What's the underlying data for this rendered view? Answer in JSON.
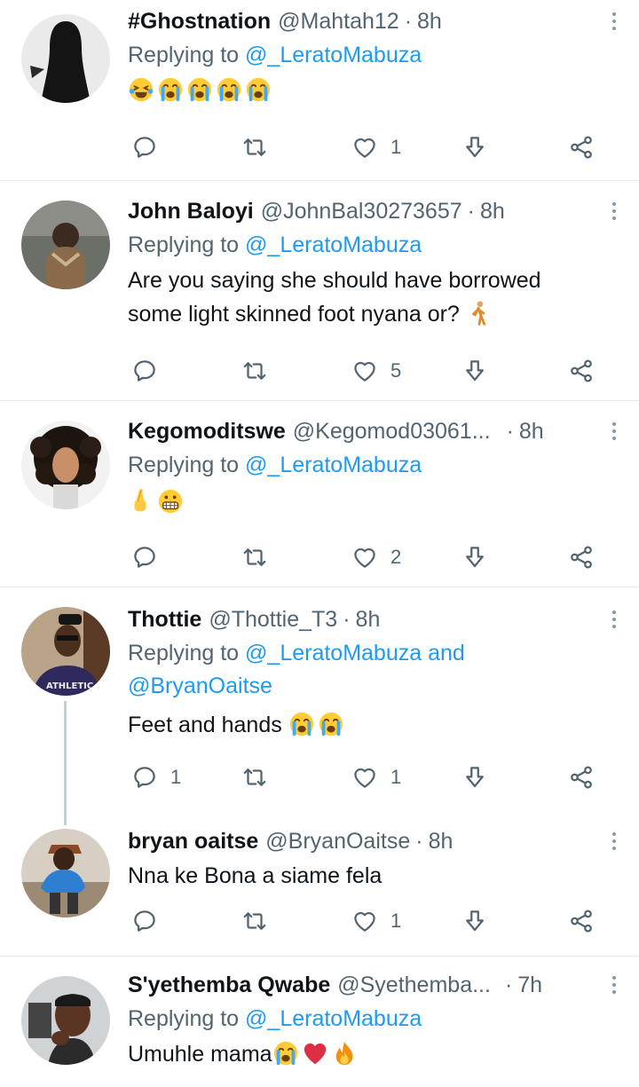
{
  "tweets": [
    {
      "name": "#Ghostnation",
      "handle": "@Mahtah12",
      "time": "8h",
      "replying_prefix": "Replying to ",
      "replying_to": "@_LeratoMabuza",
      "replying_and": "",
      "replying_to2": "",
      "text": "",
      "emojis": [
        "laughing-tears-emoji",
        "crying-emoji",
        "crying-emoji",
        "crying-emoji",
        "crying-emoji"
      ],
      "reply_count": "",
      "retweet_count": "",
      "like_count": "1"
    },
    {
      "name": "John Baloyi",
      "handle": "@JohnBal30273657",
      "time": "8h",
      "replying_prefix": "Replying to ",
      "replying_to": "@_LeratoMabuza",
      "text_line1": "Are you saying she should have borrowed",
      "text_line2": "some light skinned foot nyana or?",
      "emojis": [
        "walking-person-emoji"
      ],
      "reply_count": "",
      "retweet_count": "",
      "like_count": "5"
    },
    {
      "name": "Kegomoditswe",
      "handle": "@Kegomod03061...",
      "time": "8h",
      "replying_prefix": "Replying to ",
      "replying_to": "@_LeratoMabuza",
      "emojis": [
        "crossed-fingers-emoji",
        "grimacing-emoji"
      ],
      "reply_count": "",
      "retweet_count": "",
      "like_count": "2"
    },
    {
      "name": "Thottie",
      "handle": "@Thottie_T3",
      "time": "8h",
      "replying_prefix": "Replying to ",
      "replying_to": "@_LeratoMabuza",
      "replying_and": " and",
      "replying_to2": "@BryanOaitse",
      "text": "Feet and hands",
      "emojis": [
        "crying-emoji",
        "crying-emoji"
      ],
      "reply_count": "1",
      "retweet_count": "",
      "like_count": "1"
    },
    {
      "name": "bryan oaitse",
      "handle": "@BryanOaitse",
      "time": "8h",
      "text": "Nna ke Bona a siame fela",
      "reply_count": "",
      "retweet_count": "",
      "like_count": "1"
    },
    {
      "name": "S'yethemba Qwabe",
      "handle": "@Syethemba...",
      "time": "7h",
      "replying_prefix": "Replying to ",
      "replying_to": "@_LeratoMabuza",
      "text": "Umuhle mama",
      "emojis": [
        "crying-emoji",
        "red-heart-emoji",
        "fire-emoji"
      ]
    }
  ],
  "colors": {
    "mention": "#1d9bf0",
    "secondary": "#536471",
    "divider": "#e6ecf0"
  }
}
